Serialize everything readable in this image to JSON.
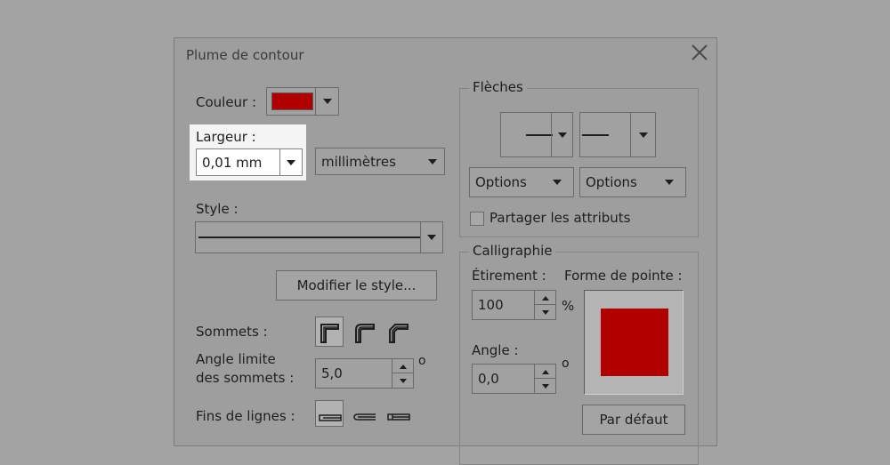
{
  "dialog": {
    "title": "Plume de contour"
  },
  "color": {
    "label": "Couleur :",
    "swatch": "#b00000"
  },
  "width": {
    "label": "Largeur :",
    "value": "0,01 mm",
    "unit": "millimètres"
  },
  "style": {
    "label": "Style :",
    "edit_button": "Modifier le style..."
  },
  "corners": {
    "label": "Sommets :"
  },
  "miter": {
    "label_line1": "Angle limite",
    "label_line2": "des sommets :",
    "value": "5,0",
    "unit": "o"
  },
  "line_caps": {
    "label": "Fins de lignes :"
  },
  "arrows": {
    "title": "Flèches",
    "options_left": "Options",
    "options_right": "Options",
    "share_label": "Partager les attributs"
  },
  "calligraphy": {
    "title": "Calligraphie",
    "stretch_label": "Étirement :",
    "stretch_value": "100",
    "stretch_unit": "%",
    "angle_label": "Angle :",
    "angle_value": "0,0",
    "angle_unit": "o",
    "nib_label": "Forme de pointe :",
    "default_button": "Par défaut",
    "nib_color": "#b00000"
  }
}
